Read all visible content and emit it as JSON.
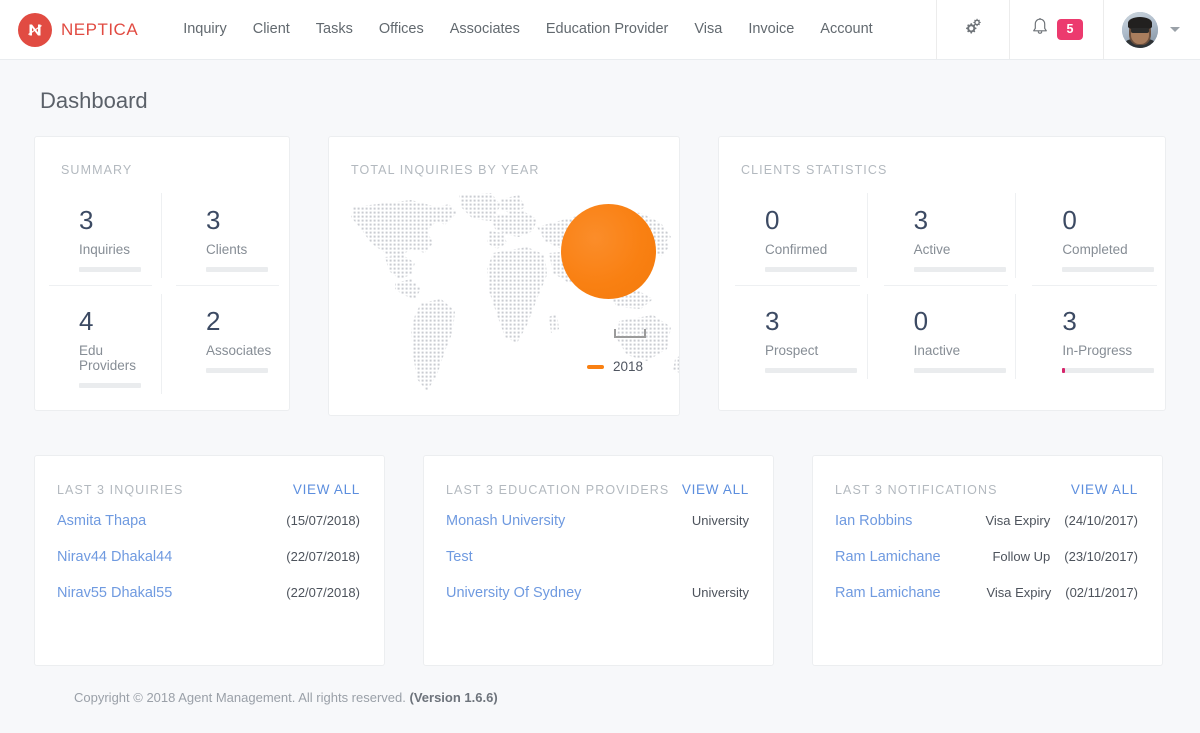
{
  "brand": {
    "name": "NEPTICA",
    "color": "#e14b42",
    "logo_icon": "neptica-n-logo"
  },
  "nav": {
    "items": [
      {
        "label": "Inquiry"
      },
      {
        "label": "Client"
      },
      {
        "label": "Tasks"
      },
      {
        "label": "Offices"
      },
      {
        "label": "Associates"
      },
      {
        "label": "Education Provider"
      },
      {
        "label": "Visa"
      },
      {
        "label": "Invoice"
      },
      {
        "label": "Account"
      }
    ],
    "settings_icon": "cogs-icon",
    "bell_icon": "bell-icon",
    "notification_count": "5",
    "badge_color": "#ec3a6e",
    "avatar_icon": "user-avatar",
    "chevron_icon": "chevron-down-icon"
  },
  "page": {
    "title": "Dashboard"
  },
  "summary": {
    "label": "SUMMARY",
    "stats": [
      {
        "value": "3",
        "label": "Inquiries",
        "fill_pct": 0
      },
      {
        "value": "3",
        "label": "Clients",
        "fill_pct": 0
      },
      {
        "value": "4",
        "label": "Edu Providers",
        "fill_pct": 0
      },
      {
        "value": "2",
        "label": "Associates",
        "fill_pct": 0
      }
    ]
  },
  "inquiries_chart": {
    "label": "TOTAL INQUIRIES BY YEAR",
    "legend_label": "2018",
    "legend_color": "#f98012",
    "map_icon": "dotted-world-map"
  },
  "chart_data": {
    "type": "pie",
    "title": "TOTAL INQUIRIES BY YEAR",
    "categories": [
      "2018"
    ],
    "values": [
      3
    ],
    "colors": [
      "#f98012"
    ],
    "legend": [
      "2018"
    ],
    "legend_position": "bottom-right",
    "overlay": "dotted world map",
    "note": "Single-slice pie (100% = 2018) rendered as a full orange circle over a dot-matrix world map",
    "grid": false
  },
  "clients": {
    "label": "CLIENTS STATISTICS",
    "stats": [
      {
        "value": "0",
        "label": "Confirmed",
        "fill_pct": 0
      },
      {
        "value": "3",
        "label": "Active",
        "fill_pct": 0
      },
      {
        "value": "0",
        "label": "Completed",
        "fill_pct": 0
      },
      {
        "value": "3",
        "label": "Prospect",
        "fill_pct": 0
      },
      {
        "value": "0",
        "label": "Inactive",
        "fill_pct": 0
      },
      {
        "value": "3",
        "label": "In-Progress",
        "fill_pct": 3
      }
    ]
  },
  "last_inquiries": {
    "label": "LAST 3 INQUIRIES",
    "view_all": "VIEW ALL",
    "rows": [
      {
        "name": "Asmita Thapa",
        "type": "",
        "date": "(15/07/2018)"
      },
      {
        "name": "Nirav44 Dhakal44",
        "type": "",
        "date": "(22/07/2018)"
      },
      {
        "name": "Nirav55 Dhakal55",
        "type": "",
        "date": "(22/07/2018)"
      }
    ]
  },
  "last_education_providers": {
    "label": "LAST 3 EDUCATION PROVIDERS",
    "view_all": "VIEW ALL",
    "rows": [
      {
        "name": "Monash University",
        "type": "University",
        "date": ""
      },
      {
        "name": "Test",
        "type": "",
        "date": ""
      },
      {
        "name": "University Of Sydney",
        "type": "University",
        "date": ""
      }
    ]
  },
  "last_notifications": {
    "label": "LAST 3 NOTIFICATIONS",
    "view_all": "VIEW ALL",
    "rows": [
      {
        "name": "Ian Robbins",
        "type": "Visa Expiry",
        "date": "(24/10/2017)"
      },
      {
        "name": "Ram Lamichane",
        "type": "Follow Up",
        "date": "(23/10/2017)"
      },
      {
        "name": "Ram Lamichane",
        "type": "Visa Expiry",
        "date": "(02/11/2017)"
      }
    ]
  },
  "footer": {
    "text": "Copyright © 2018 Agent Management. All rights reserved.",
    "version": "(Version 1.6.6)"
  }
}
